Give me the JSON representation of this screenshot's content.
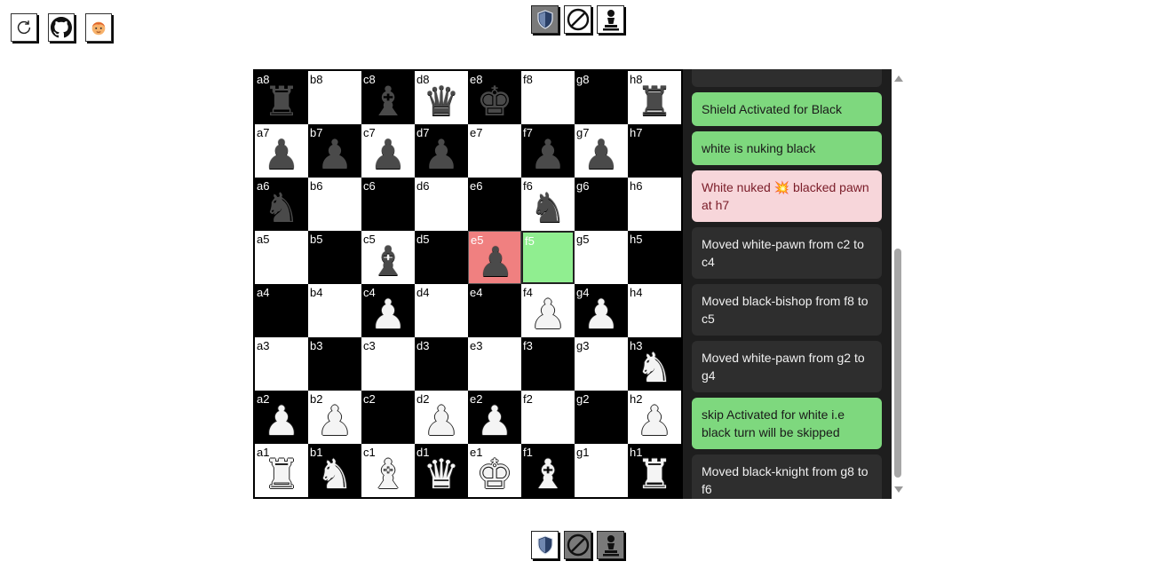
{
  "toolbar": {
    "buttons": [
      {
        "name": "reset-icon"
      },
      {
        "name": "github-icon"
      },
      {
        "name": "avatar-icon"
      }
    ]
  },
  "powerups": {
    "top": [
      {
        "name": "shield-icon",
        "active": true
      },
      {
        "name": "skip-icon",
        "active": false
      },
      {
        "name": "pawn-icon",
        "active": false
      }
    ],
    "bottom": [
      {
        "name": "shield-icon",
        "active": false
      },
      {
        "name": "skip-icon",
        "active": true
      },
      {
        "name": "pawn-icon",
        "active": true
      }
    ]
  },
  "board": {
    "files": [
      "a",
      "b",
      "c",
      "d",
      "e",
      "f",
      "g",
      "h"
    ],
    "ranks": [
      "8",
      "7",
      "6",
      "5",
      "4",
      "3",
      "2",
      "1"
    ],
    "pieces": {
      "a8": {
        "type": "rook",
        "color": "black"
      },
      "c8": {
        "type": "bishop",
        "color": "black"
      },
      "d8": {
        "type": "queen",
        "color": "black"
      },
      "e8": {
        "type": "king",
        "color": "black"
      },
      "h8": {
        "type": "rook",
        "color": "black"
      },
      "a7": {
        "type": "pawn",
        "color": "black"
      },
      "b7": {
        "type": "pawn",
        "color": "black"
      },
      "c7": {
        "type": "pawn",
        "color": "black"
      },
      "d7": {
        "type": "pawn",
        "color": "black"
      },
      "f7": {
        "type": "pawn",
        "color": "black"
      },
      "g7": {
        "type": "pawn",
        "color": "black"
      },
      "a6": {
        "type": "knight",
        "color": "black"
      },
      "f6": {
        "type": "knight",
        "color": "black"
      },
      "c5": {
        "type": "bishop",
        "color": "black"
      },
      "e5": {
        "type": "pawn",
        "color": "black"
      },
      "c4": {
        "type": "pawn",
        "color": "white"
      },
      "f4": {
        "type": "pawn",
        "color": "white"
      },
      "g4": {
        "type": "pawn",
        "color": "white"
      },
      "h3": {
        "type": "knight",
        "color": "white"
      },
      "a2": {
        "type": "pawn",
        "color": "white"
      },
      "b2": {
        "type": "pawn",
        "color": "white"
      },
      "d2": {
        "type": "pawn",
        "color": "white"
      },
      "e2": {
        "type": "pawn",
        "color": "white"
      },
      "h2": {
        "type": "pawn",
        "color": "white"
      },
      "a1": {
        "type": "rook",
        "color": "white"
      },
      "b1": {
        "type": "knight",
        "color": "white"
      },
      "c1": {
        "type": "bishop",
        "color": "white"
      },
      "d1": {
        "type": "queen",
        "color": "white"
      },
      "e1": {
        "type": "king",
        "color": "white"
      },
      "f1": {
        "type": "bishop",
        "color": "white"
      },
      "h1": {
        "type": "rook",
        "color": "white"
      }
    },
    "highlight_red": "e5",
    "highlight_green": "f5",
    "colors": {
      "light": "#ffffff",
      "dark": "#000000",
      "red": "#f08080",
      "green": "#90ee90"
    }
  },
  "log": {
    "entries": [
      {
        "text": "",
        "style": "dark"
      },
      {
        "text": "Shield Activated for Black",
        "style": "green"
      },
      {
        "text": "white is nuking black",
        "style": "green"
      },
      {
        "text": "White nuked 💥 blacked pawn at h7",
        "style": "pink"
      },
      {
        "text": "Moved white-pawn from c2 to c4",
        "style": "dark"
      },
      {
        "text": "Moved black-bishop from f8 to c5",
        "style": "dark"
      },
      {
        "text": "Moved white-pawn from g2 to g4",
        "style": "dark"
      },
      {
        "text": "skip Activated for white i.e black turn will be skipped",
        "style": "green"
      },
      {
        "text": "Moved black-knight from g8 to f6",
        "style": "dark"
      }
    ]
  }
}
